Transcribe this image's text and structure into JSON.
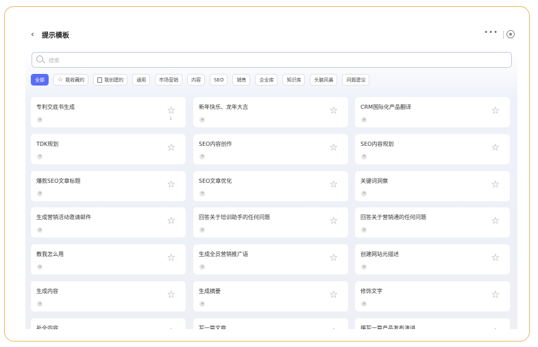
{
  "header": {
    "back_icon": "‹",
    "title": "提示模板",
    "more_icon": "•••",
    "target_icon": "target-icon"
  },
  "search": {
    "placeholder": "搜索"
  },
  "tags": [
    {
      "label": "全部",
      "active": true,
      "icon": null
    },
    {
      "label": "我收藏的",
      "active": false,
      "icon": "star"
    },
    {
      "label": "我创建的",
      "active": false,
      "icon": "doc"
    },
    {
      "label": "通用",
      "active": false,
      "icon": null
    },
    {
      "label": "市场营销",
      "active": false,
      "icon": null
    },
    {
      "label": "内容",
      "active": false,
      "icon": null
    },
    {
      "label": "SEO",
      "active": false,
      "icon": null
    },
    {
      "label": "销售",
      "active": false,
      "icon": null
    },
    {
      "label": "企业库",
      "active": false,
      "icon": null
    },
    {
      "label": "知识库",
      "active": false,
      "icon": null
    },
    {
      "label": "头脑风暴",
      "active": false,
      "icon": null
    },
    {
      "label": "问题建议",
      "active": false,
      "icon": null
    }
  ],
  "cards": [
    {
      "title": "专利交底书生成",
      "count": "1"
    },
    {
      "title": "新年快乐、龙年大吉",
      "count": ""
    },
    {
      "title": "CRM国际化产品翻译",
      "count": ""
    },
    {
      "title": "TDK规划",
      "count": ""
    },
    {
      "title": "SEO内容创作",
      "count": ""
    },
    {
      "title": "SEO内容规划",
      "count": ""
    },
    {
      "title": "爆款SEO文章标题",
      "count": ""
    },
    {
      "title": "SEO文章优化",
      "count": ""
    },
    {
      "title": "关键词洞察",
      "count": ""
    },
    {
      "title": "生成营销活动邀请邮件",
      "count": ""
    },
    {
      "title": "回答关于培训助手的任何问题",
      "count": ""
    },
    {
      "title": "回答关于营销通的任何问题",
      "count": ""
    },
    {
      "title": "教我怎么用",
      "count": ""
    },
    {
      "title": "生成全员营销推广语",
      "count": ""
    },
    {
      "title": "创建网站元描述",
      "count": ""
    },
    {
      "title": "生成内容",
      "count": ""
    },
    {
      "title": "生成摘要",
      "count": ""
    },
    {
      "title": "修饰文字",
      "count": ""
    },
    {
      "title": "补全内容",
      "count": ""
    },
    {
      "title": "写一篇文章",
      "count": ""
    },
    {
      "title": "撰写一篇产品发布演讲",
      "count": ""
    }
  ],
  "colors": {
    "accent": "#5b6cf5",
    "frame": "#e8b95f"
  }
}
